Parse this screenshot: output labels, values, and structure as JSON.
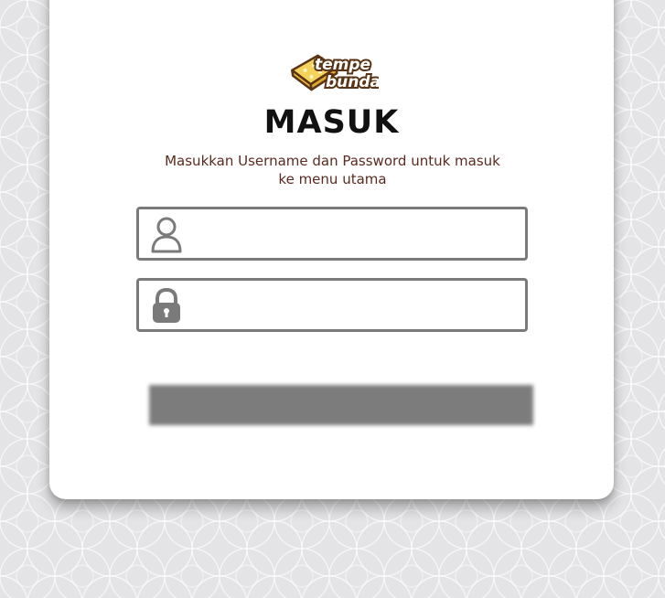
{
  "brand": {
    "logo_line1": "tempe",
    "logo_line2": "bunda"
  },
  "login": {
    "title": "MASUK",
    "subtitle": "Masukkan Username dan Password untuk masuk ke menu utama",
    "username": {
      "value": "",
      "placeholder": "",
      "icon": "user-icon"
    },
    "password": {
      "value": "",
      "placeholder": "",
      "icon": "lock-icon"
    },
    "submit_label": ""
  },
  "colors": {
    "background": "#e4e4e6",
    "card": "#ffffff",
    "title": "#111111",
    "subtitle": "#5c2a1e",
    "field_border": "#7a7a7a",
    "button": "#7c7c7c",
    "logo_yellow": "#f5d35b",
    "logo_brown": "#5a3415"
  }
}
